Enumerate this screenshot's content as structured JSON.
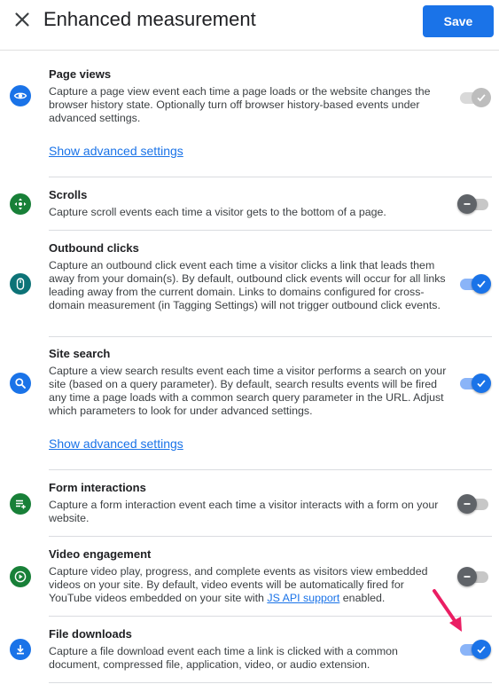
{
  "header": {
    "title": "Enhanced measurement",
    "save_label": "Save",
    "close_icon": "close-icon"
  },
  "colors": {
    "accent": "#1a73e8",
    "page_views_icon": "#1a73e8",
    "scrolls_icon": "#188038",
    "outbound_icon": "#0d7377",
    "site_search_icon": "#1a73e8",
    "form_icon": "#188038",
    "video_icon": "#188038",
    "download_icon": "#1a73e8",
    "annotation_arrow": "#ea1e63"
  },
  "sections": [
    {
      "key": "page_views",
      "title": "Page views",
      "description": "Capture a page view event each time a page loads or the website changes the browser history state. Optionally turn off browser history-based events under advanced settings.",
      "link": "Show advanced settings",
      "icon": "eye-icon",
      "toggle": "on-disabled"
    },
    {
      "key": "scrolls",
      "title": "Scrolls",
      "description": "Capture scroll events each time a visitor gets to the bottom of a page.",
      "icon": "scroll-icon",
      "toggle": "off"
    },
    {
      "key": "outbound_clicks",
      "title": "Outbound clicks",
      "description": "Capture an outbound click event each time a visitor clicks a link that leads them away from your domain(s). By default, outbound click events will occur for all links leading away from the current domain. Links to domains configured for cross-domain measurement (in Tagging Settings) will not trigger outbound click events.",
      "icon": "mouse-icon",
      "toggle": "on"
    },
    {
      "key": "site_search",
      "title": "Site search",
      "description": "Capture a view search results event each time a visitor performs a search on your site (based on a query parameter). By default, search results events will be fired any time a page loads with a common search query parameter in the URL. Adjust which parameters to look for under advanced settings.",
      "link": "Show advanced settings",
      "icon": "search-icon",
      "toggle": "on"
    },
    {
      "key": "form_interactions",
      "title": "Form interactions",
      "description": "Capture a form interaction event each time a visitor interacts with a form on your website.",
      "icon": "form-icon",
      "toggle": "off"
    },
    {
      "key": "video_engagement",
      "title": "Video engagement",
      "description_before": "Capture video play, progress, and complete events as visitors view embedded videos on your site. By default, video events will be automatically fired for YouTube videos embedded on your site with ",
      "description_link": "JS API support",
      "description_after": " enabled.",
      "icon": "play-icon",
      "toggle": "off"
    },
    {
      "key": "file_downloads",
      "title": "File downloads",
      "description": "Capture a file download event each time a link is clicked with a common document, compressed file, application, video, or audio extension.",
      "icon": "download-icon",
      "toggle": "on"
    }
  ]
}
